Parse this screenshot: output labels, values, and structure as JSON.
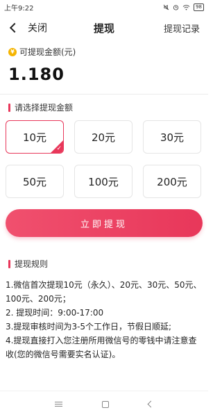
{
  "status": {
    "time": "上午9:22",
    "battery": "98"
  },
  "nav": {
    "back_label": "关闭",
    "title": "提现",
    "right_label": "提现记录"
  },
  "balance": {
    "label": "可提现金额(元)",
    "value": "1.180",
    "coin_glyph": "¥"
  },
  "amounts": {
    "section_title": "请选择提现金额",
    "options": [
      "10元",
      "20元",
      "30元",
      "50元",
      "100元",
      "200元"
    ],
    "selected": "10元"
  },
  "withdraw_button": "立即提现",
  "rules": {
    "title": "提现规则",
    "lines": [
      "1.微信首次提现10元（永久）、20元、30元、50元、100元、200元；",
      "2. 提现时间：9:00-17:00",
      "3.提现审核时间为3-5个工作日，节假日顺延;",
      "4.提现直接打入您注册所用微信号的零钱中请注意查收(您的微信号需要实名认证)。"
    ]
  },
  "colors": {
    "accent": "#e8375a",
    "coin": "#f5b400"
  }
}
